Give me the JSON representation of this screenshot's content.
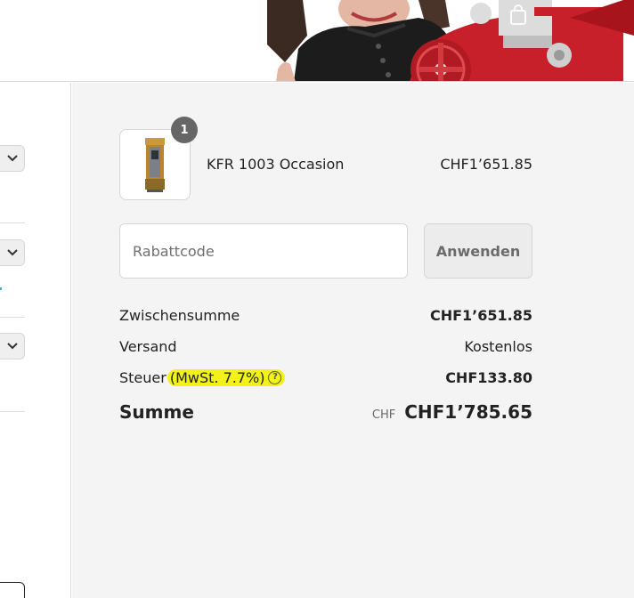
{
  "header": {
    "cart_icon": "shopping-bag-icon"
  },
  "left_panel": {
    "dropdown_icon": "chevron-down-icon"
  },
  "order_summary": {
    "item": {
      "quantity": "1",
      "name": "KFR 1003 Occasion",
      "price": "CHF1’651.85"
    },
    "discount": {
      "placeholder": "Rabattcode",
      "apply_label": "Anwenden"
    },
    "subtotal": {
      "label": "Zwischensumme",
      "value": "CHF1’651.85"
    },
    "shipping": {
      "label": "Versand",
      "value": "Kostenlos"
    },
    "tax": {
      "label": "Steuer",
      "rate_label": "(MwSt. 7.7%)",
      "value": "CHF133.80",
      "help_icon": "question-circle-icon"
    },
    "total": {
      "label": "Summe",
      "currency": "CHF",
      "value": "CHF1’785.65"
    }
  },
  "colors": {
    "panel_bg": "#f4f4f4",
    "badge_bg": "#666666",
    "highlight": "#f2f21a",
    "accent_red": "#c8202a"
  }
}
